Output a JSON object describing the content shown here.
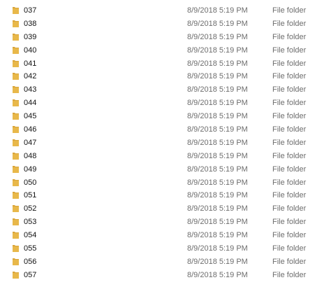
{
  "folder_icon_color": "#e8b84a",
  "rows": [
    {
      "name": "037",
      "date_modified": "8/9/2018 5:19 PM",
      "type": "File folder",
      "icon": "folder-icon"
    },
    {
      "name": "038",
      "date_modified": "8/9/2018 5:19 PM",
      "type": "File folder",
      "icon": "folder-icon"
    },
    {
      "name": "039",
      "date_modified": "8/9/2018 5:19 PM",
      "type": "File folder",
      "icon": "folder-icon"
    },
    {
      "name": "040",
      "date_modified": "8/9/2018 5:19 PM",
      "type": "File folder",
      "icon": "folder-icon"
    },
    {
      "name": "041",
      "date_modified": "8/9/2018 5:19 PM",
      "type": "File folder",
      "icon": "folder-icon"
    },
    {
      "name": "042",
      "date_modified": "8/9/2018 5:19 PM",
      "type": "File folder",
      "icon": "folder-icon"
    },
    {
      "name": "043",
      "date_modified": "8/9/2018 5:19 PM",
      "type": "File folder",
      "icon": "folder-icon"
    },
    {
      "name": "044",
      "date_modified": "8/9/2018 5:19 PM",
      "type": "File folder",
      "icon": "folder-icon"
    },
    {
      "name": "045",
      "date_modified": "8/9/2018 5:19 PM",
      "type": "File folder",
      "icon": "folder-icon"
    },
    {
      "name": "046",
      "date_modified": "8/9/2018 5:19 PM",
      "type": "File folder",
      "icon": "folder-icon"
    },
    {
      "name": "047",
      "date_modified": "8/9/2018 5:19 PM",
      "type": "File folder",
      "icon": "folder-icon"
    },
    {
      "name": "048",
      "date_modified": "8/9/2018 5:19 PM",
      "type": "File folder",
      "icon": "folder-icon"
    },
    {
      "name": "049",
      "date_modified": "8/9/2018 5:19 PM",
      "type": "File folder",
      "icon": "folder-icon"
    },
    {
      "name": "050",
      "date_modified": "8/9/2018 5:19 PM",
      "type": "File folder",
      "icon": "folder-icon"
    },
    {
      "name": "051",
      "date_modified": "8/9/2018 5:19 PM",
      "type": "File folder",
      "icon": "folder-icon"
    },
    {
      "name": "052",
      "date_modified": "8/9/2018 5:19 PM",
      "type": "File folder",
      "icon": "folder-icon"
    },
    {
      "name": "053",
      "date_modified": "8/9/2018 5:19 PM",
      "type": "File folder",
      "icon": "folder-icon"
    },
    {
      "name": "054",
      "date_modified": "8/9/2018 5:19 PM",
      "type": "File folder",
      "icon": "folder-icon"
    },
    {
      "name": "055",
      "date_modified": "8/9/2018 5:19 PM",
      "type": "File folder",
      "icon": "folder-icon"
    },
    {
      "name": "056",
      "date_modified": "8/9/2018 5:19 PM",
      "type": "File folder",
      "icon": "folder-icon"
    },
    {
      "name": "057",
      "date_modified": "8/9/2018 5:19 PM",
      "type": "File folder",
      "icon": "folder-icon"
    }
  ]
}
